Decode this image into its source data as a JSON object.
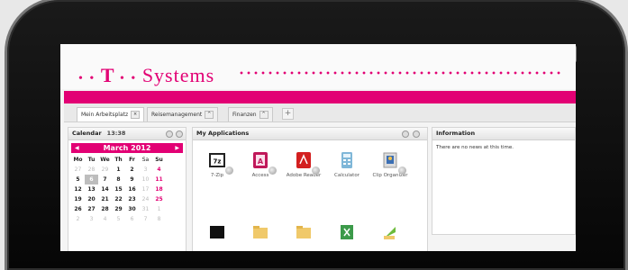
{
  "logo": {
    "dots_left": "• • ",
    "t_letter": "T",
    "mid_dots": " • • ",
    "name": "Systems"
  },
  "window": {
    "close_label": "×"
  },
  "tabs": [
    {
      "label": "Mein Arbeitsplatz",
      "close": "×"
    },
    {
      "label": "Reisemanagement",
      "close": "^"
    },
    {
      "label": "Finanzen",
      "close": "^"
    }
  ],
  "tab_add": "+",
  "calendar": {
    "title": "Calendar",
    "time": "13:38",
    "month": "March 2012",
    "prev": "◀",
    "next": "▶",
    "weekdays": [
      "Mo",
      "Tu",
      "We",
      "Th",
      "Fr",
      "Sa",
      "Su"
    ],
    "weeks": [
      [
        "27",
        "28",
        "29",
        "1",
        "2",
        "3",
        "4"
      ],
      [
        "5",
        "6",
        "7",
        "8",
        "9",
        "10",
        "11"
      ],
      [
        "12",
        "13",
        "14",
        "15",
        "16",
        "17",
        "18"
      ],
      [
        "19",
        "20",
        "21",
        "22",
        "23",
        "24",
        "25"
      ],
      [
        "26",
        "27",
        "28",
        "29",
        "30",
        "31",
        "1"
      ],
      [
        "2",
        "3",
        "4",
        "5",
        "6",
        "7",
        "8"
      ]
    ]
  },
  "apps": {
    "title": "My Applications",
    "items": [
      {
        "label": "7-Zip",
        "icon": "7zip-icon"
      },
      {
        "label": "Access",
        "icon": "access-icon"
      },
      {
        "label": "Adobe Reader",
        "icon": "adobe-reader-icon"
      },
      {
        "label": "Calculator",
        "icon": "calculator-icon"
      },
      {
        "label": "Clip Organizer",
        "icon": "clip-organizer-icon"
      }
    ]
  },
  "info": {
    "title": "Information",
    "text": "There are no news at this time."
  },
  "colors": {
    "brand": "#e20074"
  }
}
